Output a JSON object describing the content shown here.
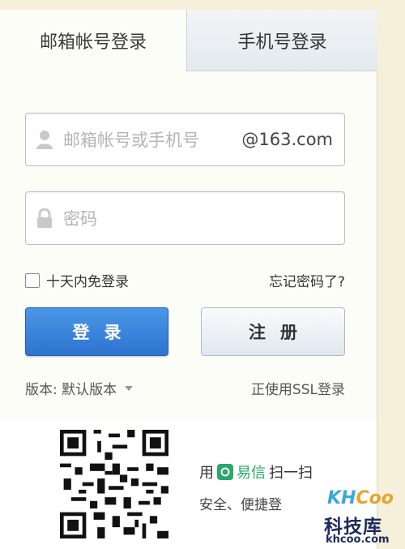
{
  "tabs": {
    "email_login": "邮箱帐号登录",
    "phone_login": "手机号登录"
  },
  "account": {
    "placeholder": "邮箱帐号或手机号",
    "domain_suffix": "@163.com"
  },
  "password": {
    "placeholder": "密码"
  },
  "remember_label": "十天内免登录",
  "forgot_label": "忘记密码了?",
  "login_label": "登录",
  "register_label": "注册",
  "version": {
    "label": "版本: 默认版本"
  },
  "ssl_label": "正使用SSL登录",
  "yixin": {
    "prefix": "用",
    "name": "易信",
    "suffix": "扫一扫",
    "safe_text": "安全、便捷登"
  },
  "watermark": {
    "logo_kh": "KH",
    "logo_coo": "Coo",
    "cn": "科技库",
    "url": "khcoo.com"
  },
  "colors": {
    "accent": "#2e73cf",
    "yixin_green": "#2aa86a",
    "page_bg": "#f6efd9"
  }
}
